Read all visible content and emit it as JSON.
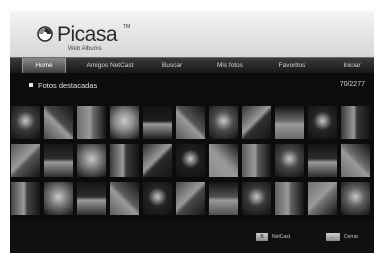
{
  "app": {
    "logo_word": "Picasa",
    "logo_tm": "TM",
    "logo_sub": "Web Albums"
  },
  "nav": {
    "tabs": [
      {
        "label": "Home",
        "active": true
      },
      {
        "label": "Amigos NetCast",
        "active": false
      },
      {
        "label": "Buscar",
        "active": false
      },
      {
        "label": "Mis fotos",
        "active": false
      },
      {
        "label": "Favoritos",
        "active": false
      },
      {
        "label": "Iniciar",
        "active": false
      }
    ]
  },
  "section": {
    "title": "Fotos destacadas",
    "counter": "70/2277"
  },
  "photos": {
    "rows": 3,
    "columns": 11,
    "tones": [
      [
        "#3a3a3a",
        "#4a4a4a",
        "#6e6e6e",
        "#8c8c8c",
        "#1c1c1c",
        "#555555",
        "#4e4e4e",
        "#303030",
        "#6a6a6a",
        "#262626",
        "#363636"
      ],
      [
        "#555555",
        "#2e2e2e",
        "#7a7a7a",
        "#3c3c3c",
        "#2a2a2a",
        "#1e1e1e",
        "#8a8a8a",
        "#5a5a5a",
        "#464646",
        "#2c2c2c",
        "#6c6c6c"
      ],
      [
        "#444444",
        "#767676",
        "#2e2e2e",
        "#5c5c5c",
        "#242424",
        "#484848",
        "#505050",
        "#383838",
        "#606060",
        "#707070",
        "#5e5e5e"
      ]
    ]
  },
  "footer": {
    "netcast_key": "B",
    "netcast_label": "NetCast",
    "close_key": "←",
    "close_label": "Cerrar"
  },
  "colors": {
    "logo_blue": "#1f5fa8",
    "logo_gray": "#8a8a8a"
  }
}
